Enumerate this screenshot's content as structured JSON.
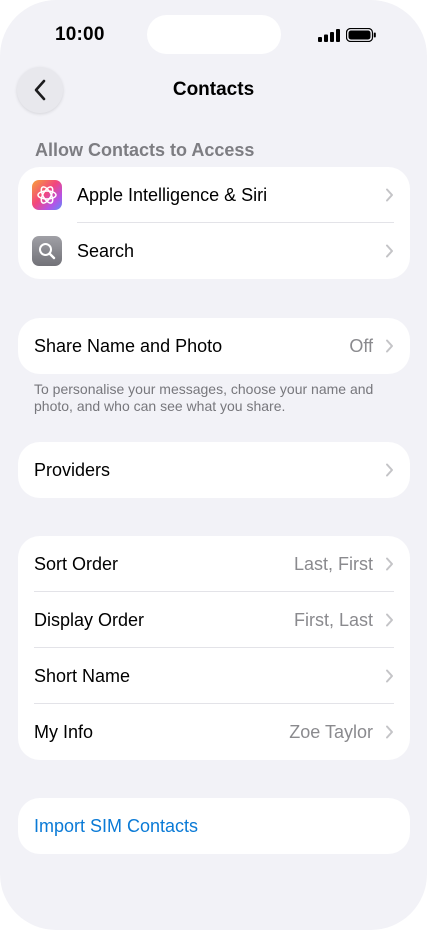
{
  "status_bar": {
    "time": "10:00"
  },
  "nav": {
    "title": "Contacts",
    "back_icon": "chevron-left-icon"
  },
  "access_section": {
    "header": "Allow Contacts to Access",
    "items": [
      {
        "label": "Apple Intelligence & Siri",
        "icon": "apple-intelligence-icon"
      },
      {
        "label": "Search",
        "icon": "search-icon"
      }
    ]
  },
  "share_section": {
    "label": "Share Name and Photo",
    "value": "Off",
    "footer": "To personalise your messages, choose your name and photo, and who can see what you share."
  },
  "providers_section": {
    "label": "Providers"
  },
  "display_section": {
    "items": [
      {
        "label": "Sort Order",
        "value": "Last, First"
      },
      {
        "label": "Display Order",
        "value": "First, Last"
      },
      {
        "label": "Short Name",
        "value": ""
      },
      {
        "label": "My Info",
        "value": "Zoe Taylor"
      }
    ]
  },
  "import_section": {
    "label": "Import SIM Contacts"
  },
  "colors": {
    "background": "#f2f2f7",
    "card": "#ffffff",
    "link": "#0a7ad6",
    "secondary_text": "#8a8a8e"
  }
}
